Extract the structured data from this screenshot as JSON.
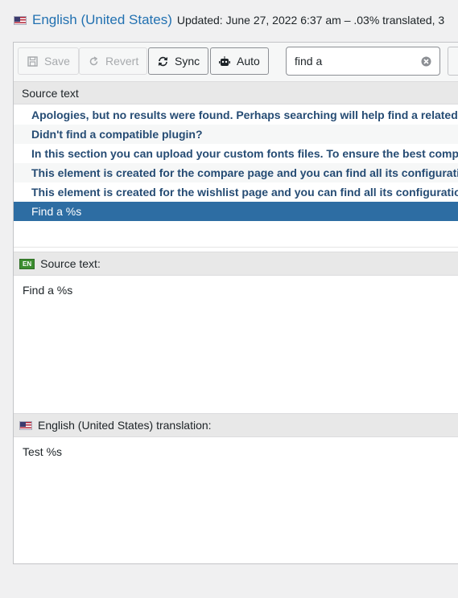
{
  "header": {
    "language": "English (United States)",
    "updated": "Updated: June 27, 2022 6:37 am – .03% translated, 3"
  },
  "toolbar": {
    "save_label": "Save",
    "revert_label": "Revert",
    "sync_label": "Sync",
    "auto_label": "Auto",
    "search_value": "find a"
  },
  "list": {
    "header": "Source text",
    "rows": [
      "Apologies, but no results were found. Perhaps searching will help find a related post.",
      "Didn't find a compatible plugin?",
      "In this section you can upload your custom fonts files. To ensure the best compatibility",
      "This element is created for the compare page and you can find all its configuration",
      "This element is created for the wishlist page and you can find all its configuration",
      "Find a %s"
    ],
    "selected_index": 5
  },
  "source_panel": {
    "badge": "EN",
    "title": "Source text:",
    "text": "Find a %s"
  },
  "translation_panel": {
    "title": "English (United States) translation:",
    "text": "Test %s"
  },
  "colors": {
    "accent": "#2271b1",
    "selected_row": "#2d6da3",
    "row_text": "#264c74"
  }
}
